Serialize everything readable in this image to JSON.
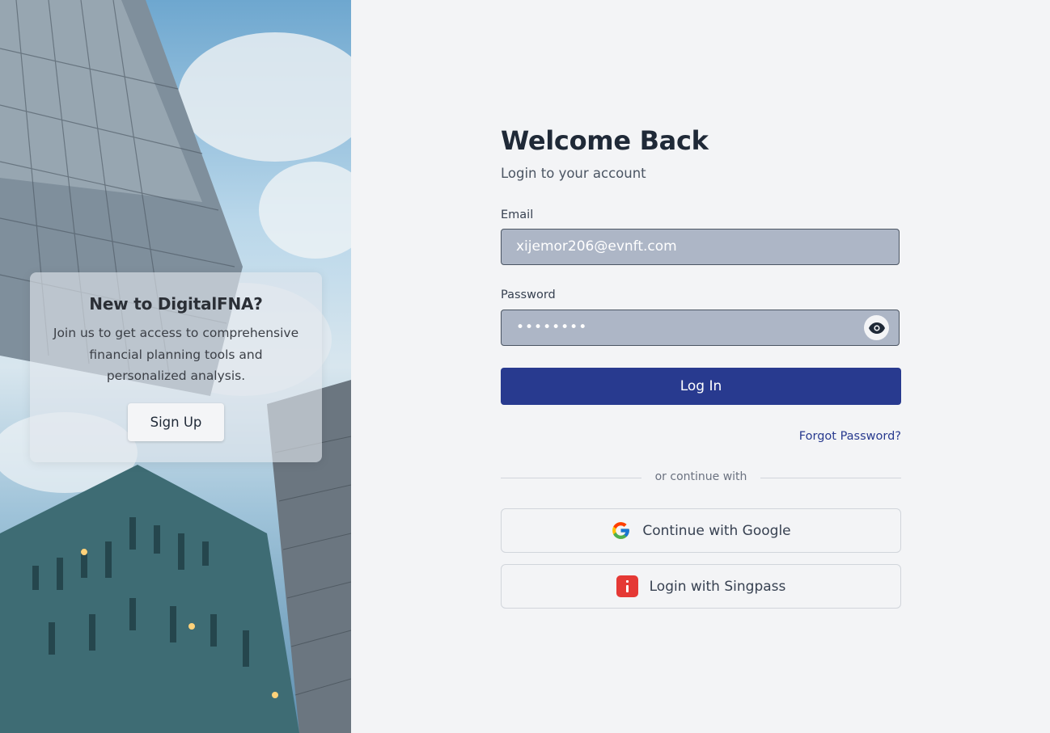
{
  "promo": {
    "title": "New to DigitalFNA?",
    "description": "Join us to get access to comprehensive financial planning tools and personalized analysis.",
    "signup_label": "Sign Up"
  },
  "login": {
    "title": "Welcome Back",
    "subtitle": "Login to your account",
    "email_label": "Email",
    "email_value": "xijemor206@evnft.com",
    "password_label": "Password",
    "password_value": "••••••••",
    "login_label": "Log In",
    "forgot_label": "Forgot Password?",
    "divider_text": "or continue with",
    "google_label": "Continue with Google",
    "singpass_label": "Login with Singpass"
  },
  "colors": {
    "primary": "#283a8f",
    "input_bg": "#adb6c6",
    "singpass": "#e53935",
    "page_bg": "#f3f4f6"
  },
  "icons": {
    "show_password": "eye-icon",
    "google": "google-icon",
    "singpass": "singpass-icon"
  }
}
